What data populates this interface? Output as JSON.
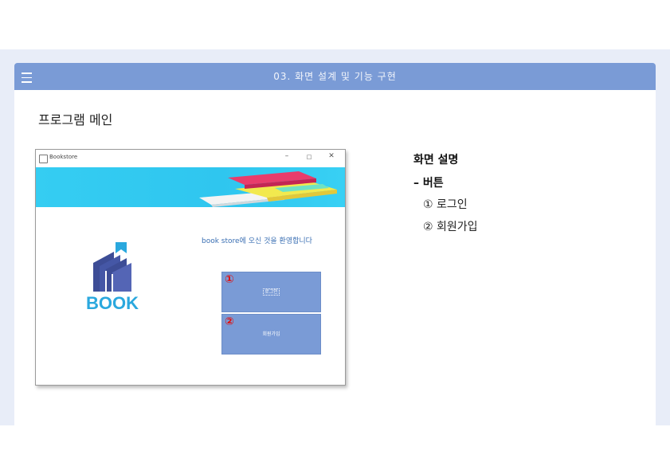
{
  "header": {
    "title": "03. 화면 설계 및 기능 구현",
    "menu_icon": "hamburger-menu-icon"
  },
  "page": {
    "title": "프로그램 메인"
  },
  "app_window": {
    "title": "Bookstore",
    "controls": {
      "minimize": "–",
      "maximize": "□",
      "close": "✕"
    },
    "welcome_text": "book store에 오신 것을 환영합니다",
    "logo_text": "BOOK",
    "buttons": [
      {
        "label": "로그인",
        "marker": "①"
      },
      {
        "label": "회원가입",
        "marker": "②"
      }
    ]
  },
  "description": {
    "title": "화면 설명",
    "subtitle": "– 버튼",
    "items": [
      "① 로그인",
      "② 회원가입"
    ]
  },
  "colors": {
    "header": "#7a9bd6",
    "band": "#e8edf8",
    "banner": "#35cdf2",
    "logo_primary": "#3d4d96",
    "logo_text": "#2aa8de",
    "marker": "#e01010"
  }
}
